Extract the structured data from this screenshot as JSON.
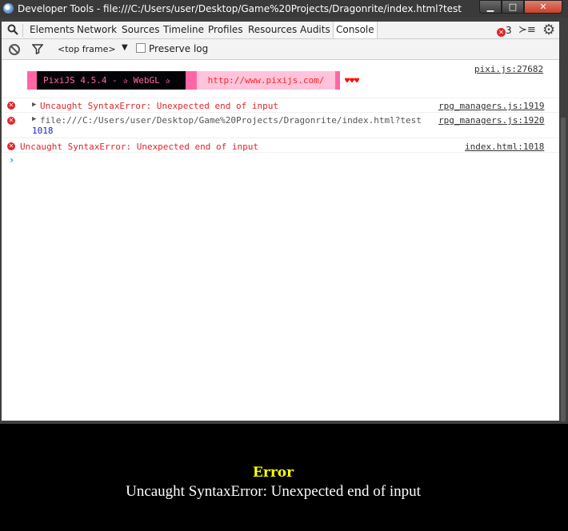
{
  "window": {
    "title": "Developer Tools - file:///C:/Users/user/Desktop/Game%20Projects/Dragonrite/index.html?test",
    "min_glyph": "▁",
    "max_glyph": "□",
    "close_glyph": "✕"
  },
  "tabs": [
    "Elements",
    "Network",
    "Sources",
    "Timeline",
    "Profiles",
    "Resources",
    "Audits",
    "Console"
  ],
  "active_tab": "Console",
  "error_count": "3",
  "toolbar": {
    "frame": "<top frame>",
    "frame_arrow": "▼",
    "preserve_log": "Preserve log"
  },
  "console": {
    "pixi": {
      "source": "pixi.js:27682",
      "label": "PixiJS 4.5.4 - ✰ WebGL ✰",
      "url": "http://www.pixijs.com/",
      "hearts": "♥♥♥"
    },
    "messages": [
      {
        "text": "Uncaught SyntaxError: Unexpected end of input",
        "source": "rpg_managers.js:1919"
      },
      {
        "text": "file:///C:/Users/user/Desktop/Game%20Projects/Dragonrite/index.html?test",
        "line2": "1018",
        "source": "rpg_managers.js:1920"
      },
      {
        "text": "Uncaught SyntaxError: Unexpected end of input",
        "source": "index.html:1018"
      }
    ],
    "prompt": "›"
  },
  "overlay": {
    "title": "Error",
    "message": "Uncaught SyntaxError: Unexpected end of input"
  },
  "colors": {
    "error_red": "#e0252b",
    "pixi_pink": "#ff66a5",
    "overlay_title": "#ffff00"
  },
  "icons": {
    "app": "chrome-devtools-icon",
    "search": "search-icon",
    "drawer": "console-drawer-icon",
    "settings": "gear-icon",
    "clear": "clear-console-icon",
    "filter": "filter-icon",
    "error": "error-icon",
    "expand": "expand-triangle-icon"
  }
}
